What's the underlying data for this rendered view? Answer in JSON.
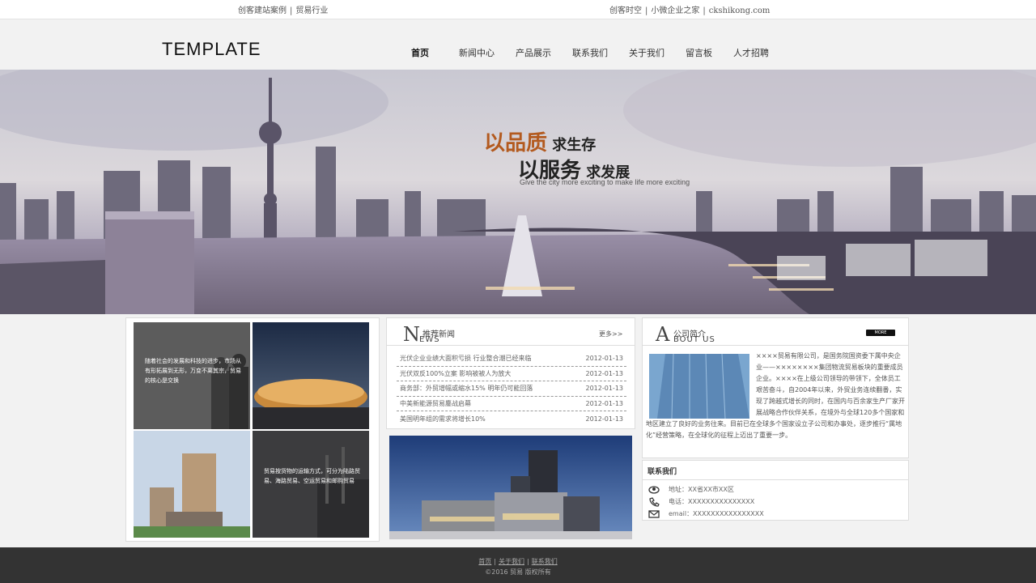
{
  "topbar": {
    "left_links": [
      "创客建站案例",
      "贸易行业"
    ],
    "right_links": [
      "创客时空",
      "小微企业之家",
      "ckshikong.com"
    ],
    "separator": "|"
  },
  "header": {
    "logo": "TEMPLATE",
    "nav": [
      "首页",
      "新闻中心",
      "产品展示",
      "联系我们",
      "关于我们",
      "留言板",
      "人才招聘"
    ]
  },
  "banner": {
    "line1_em": "以品质",
    "line1": "求生存",
    "line2_em": "以服务",
    "line2": "求发展",
    "subtitle": "Give the city more exciting to make life more exciting"
  },
  "gallery": {
    "text1": "随着社会的发展和科技的进步，市场从有形拓展到无形，万变不离其宗，贸易的核心是交换",
    "text2": "贸易按货物的运输方式，可分为陆路贸易、海路贸易、空运贸易和邮购贸易"
  },
  "news": {
    "letter": "N",
    "title_cn": "推荐新闻",
    "title_en": "EWS",
    "more": "更多>>",
    "items": [
      {
        "title": "光伏企业业绩大面积亏损 行业整合潮已经来临",
        "date": "2012-01-13"
      },
      {
        "title": "光伏双反100%立案 影响被被人为放大",
        "date": "2012-01-13"
      },
      {
        "title": "商务部：外贸增幅或缩水15% 明年仍可能回落",
        "date": "2012-01-13"
      },
      {
        "title": "中美新能源贸易鏖战启幕",
        "date": "2012-01-13"
      },
      {
        "title": "美国明年组的需求将增长10%",
        "date": "2012-01-13"
      }
    ]
  },
  "about": {
    "letter": "A",
    "title_cn": "公司简介",
    "title_en": "BOUT US",
    "more": "MORE",
    "text": "××××贸易有限公司，是国务院国资委下属中央企业——××××××××集团物流贸易板块的重要成员企业。××××在上级公司领导的带领下，全体员工艰苦奋斗，自2004年以来，外贸业务连续翻番，实现了跨越式增长的同时，在国内与百余家生产厂家开展战略合作伙伴关系，在境外与全球120多个国家和地区建立了良好的业务往来。目前已在全球多个国家设立子公司和办事处，逐步推行“属地化”经营策略，在全球化的征程上迈出了重要一步。"
  },
  "contact": {
    "title": "联系我们",
    "address": "地址：XX省XX市XX区",
    "phone": "电话：XXXXXXXXXXXXXXX",
    "email": "email：XXXXXXXXXXXXXXXX"
  },
  "footer": {
    "links": [
      "首页",
      "关于我们",
      "联系我们"
    ],
    "separator": "|",
    "copyright": "©2016 贸易 版权所有"
  }
}
